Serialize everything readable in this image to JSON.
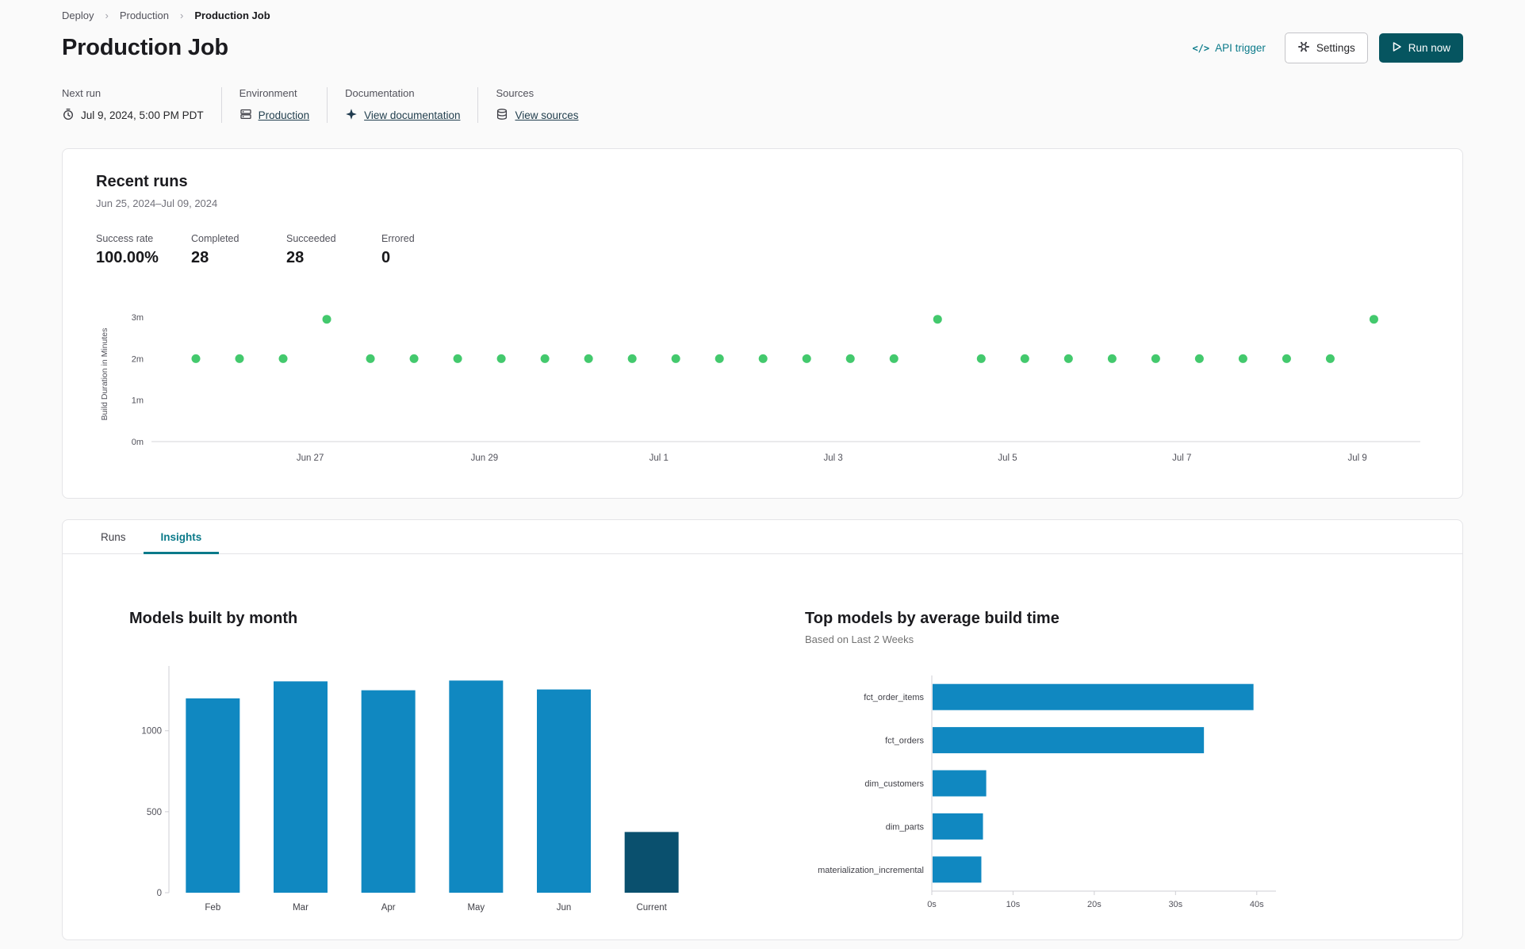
{
  "breadcrumb": {
    "items": [
      {
        "label": "Deploy"
      },
      {
        "label": "Production"
      },
      {
        "label": "Production Job"
      }
    ]
  },
  "header": {
    "title": "Production Job",
    "api_trigger_icon": "</>",
    "api_trigger_label": "API trigger",
    "settings_label": "Settings",
    "run_now_label": "Run now"
  },
  "info_bar": {
    "next_run": {
      "label": "Next run",
      "value": "Jul 9, 2024, 5:00 PM PDT"
    },
    "environment": {
      "label": "Environment",
      "value": "Production"
    },
    "documentation": {
      "label": "Documentation",
      "value": "View documentation"
    },
    "sources": {
      "label": "Sources",
      "value": "View sources"
    }
  },
  "recent_runs": {
    "title": "Recent runs",
    "date_range": "Jun 25, 2024–Jul 09, 2024",
    "stats": [
      {
        "label": "Success rate",
        "value": "100.00%"
      },
      {
        "label": "Completed",
        "value": "28"
      },
      {
        "label": "Succeeded",
        "value": "28"
      },
      {
        "label": "Errored",
        "value": "0"
      }
    ]
  },
  "tabs": [
    {
      "label": "Runs",
      "active": false
    },
    {
      "label": "Insights",
      "active": true
    }
  ],
  "colors": {
    "accent_teal": "#0b7a8a",
    "run_now_bg": "#065560",
    "dot_green": "#43c96d",
    "bar_blue": "#1088c1",
    "bar_dark_blue": "#0a506e"
  },
  "chart_data": [
    {
      "id": "build-duration-scatter",
      "type": "scatter",
      "ylabel": "Build Duration in Minutes",
      "ylim": [
        0,
        3.25
      ],
      "y_ticks": [
        {
          "v": 0,
          "label": "0m"
        },
        {
          "v": 1,
          "label": "1m"
        },
        {
          "v": 2,
          "label": "2m"
        },
        {
          "v": 3,
          "label": "3m"
        }
      ],
      "x_ticks": [
        {
          "label": "Jun 27",
          "frac": 0.097
        },
        {
          "label": "Jun 29",
          "frac": 0.245
        },
        {
          "label": "Jul 1",
          "frac": 0.393
        },
        {
          "label": "Jul 3",
          "frac": 0.541
        },
        {
          "label": "Jul 5",
          "frac": 0.689
        },
        {
          "label": "Jul 7",
          "frac": 0.837
        },
        {
          "label": "Jul 9",
          "frac": 0.986
        }
      ],
      "points_minutes": [
        2,
        2,
        2,
        2.95,
        2,
        2,
        2,
        2,
        2,
        2,
        2,
        2,
        2,
        2,
        2,
        2,
        2,
        2.95,
        2,
        2,
        2,
        2,
        2,
        2,
        2,
        2,
        2,
        2.95
      ],
      "point_color": "#43c96d"
    },
    {
      "id": "models-built-by-month",
      "type": "bar",
      "title": "Models built by month",
      "categories": [
        "Feb",
        "Mar",
        "Apr",
        "May",
        "Jun",
        "Current"
      ],
      "values": [
        1200,
        1305,
        1250,
        1310,
        1255,
        375
      ],
      "bar_colors": [
        "#1088c1",
        "#1088c1",
        "#1088c1",
        "#1088c1",
        "#1088c1",
        "#0a506e"
      ],
      "y_ticks": [
        {
          "v": 0,
          "label": "0"
        },
        {
          "v": 500,
          "label": "500"
        },
        {
          "v": 1000,
          "label": "1000"
        }
      ],
      "ylim": [
        0,
        1400
      ]
    },
    {
      "id": "top-models-by-average-build-time",
      "type": "hbar",
      "title": "Top models by average build time",
      "subtitle": "Based on Last 2 Weeks",
      "categories": [
        "fct_order_items",
        "fct_orders",
        "dim_customers",
        "dim_parts",
        "materialization_incremental"
      ],
      "values_seconds": [
        39.5,
        33.4,
        6.6,
        6.2,
        6.0
      ],
      "x_ticks": [
        {
          "v": 0,
          "label": "0s"
        },
        {
          "v": 10,
          "label": "10s"
        },
        {
          "v": 20,
          "label": "20s"
        },
        {
          "v": 30,
          "label": "30s"
        },
        {
          "v": 40,
          "label": "40s"
        }
      ],
      "xlim": [
        0,
        41
      ],
      "bar_color": "#1088c1"
    }
  ]
}
